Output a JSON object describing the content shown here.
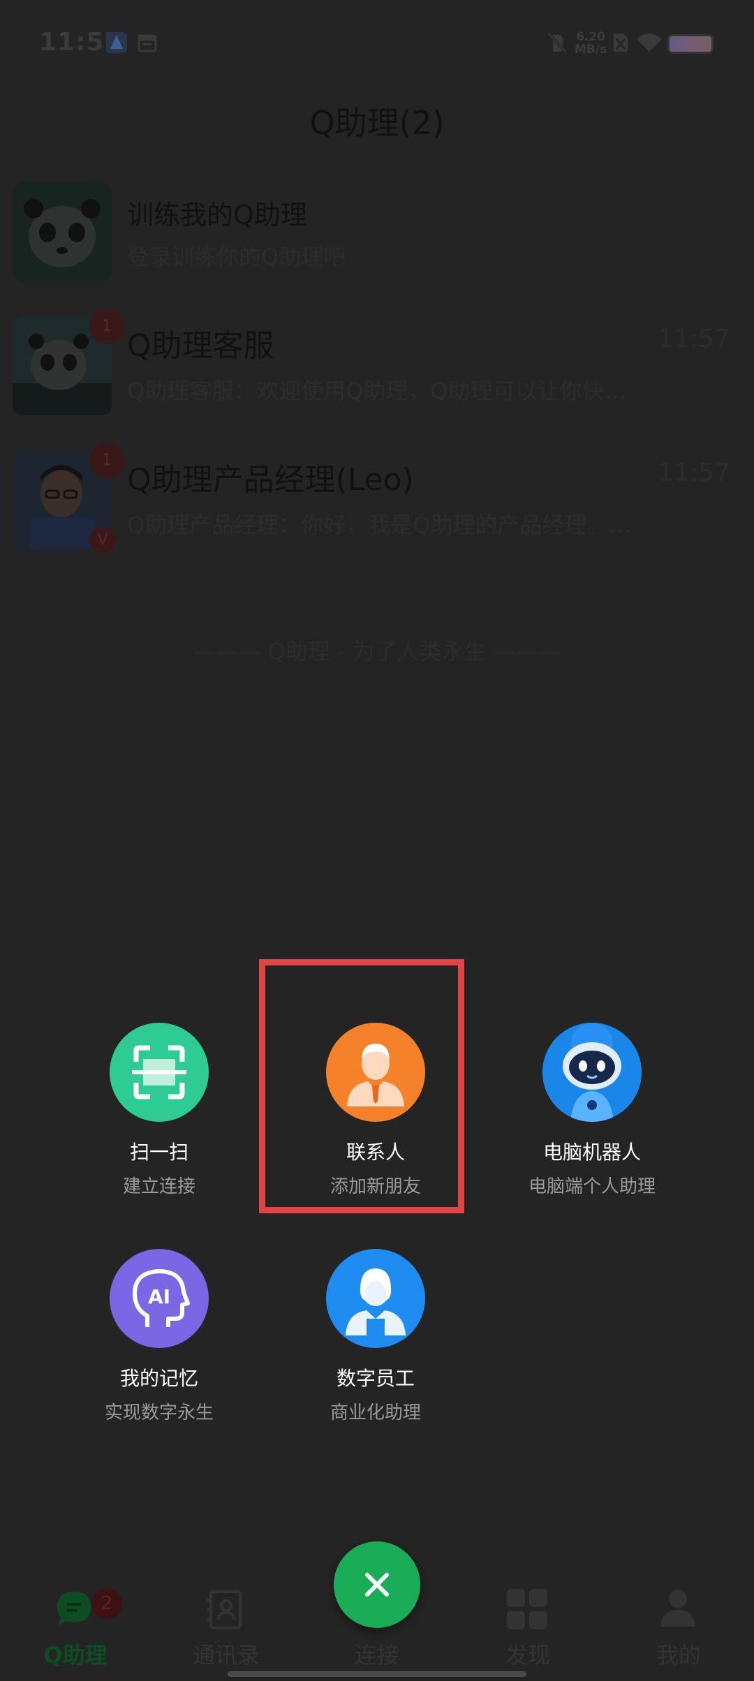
{
  "status_bar": {
    "time": "11:57",
    "net_speed_value": "6.20",
    "net_speed_unit": "MB/s",
    "icons": [
      "app-notification-icon",
      "calendar-icon",
      "mute-icon",
      "sim-icon",
      "wifi-icon",
      "battery-icon"
    ]
  },
  "header": {
    "title": "Q助理(2)"
  },
  "chats": [
    {
      "name": "训练我的Q助理",
      "preview": "登录训练你的Q助理吧",
      "time": "",
      "badge": ""
    },
    {
      "name": "Q助理客服",
      "preview": "Q助理客服：欢迎使用Q助理，Q助理可以让你快…",
      "time": "11:57",
      "badge": "1"
    },
    {
      "name": "Q助理产品经理(Leo)",
      "preview": "Q助理产品经理：你好，我是Q助理的产品经理。…",
      "time": "11:57",
      "badge": "1",
      "verified": "V"
    }
  ],
  "footer_slogan": "——— Q助理 - 为了人类永生 ———",
  "menu": [
    {
      "label": "扫一扫",
      "sub": "建立连接",
      "icon": "scan-icon",
      "color": "#2fcb94"
    },
    {
      "label": "联系人",
      "sub": "添加新朋友",
      "icon": "contact-person-icon",
      "color": "#f5822a"
    },
    {
      "label": "电脑机器人",
      "sub": "电脑端个人助理",
      "icon": "robot-icon",
      "color": "#1f7fe0"
    },
    {
      "label": "我的记忆",
      "sub": "实现数字永生",
      "icon": "ai-head-icon",
      "color": "#7b66e3"
    },
    {
      "label": "数字员工",
      "sub": "商业化助理",
      "icon": "employee-icon",
      "color": "#1f8cf2"
    }
  ],
  "bottom_nav": [
    {
      "label": "Q助理",
      "icon": "chat-bubble-icon",
      "badge": "2",
      "active": true
    },
    {
      "label": "通讯录",
      "icon": "contacts-book-icon"
    },
    {
      "label": "连接",
      "icon": "close-icon"
    },
    {
      "label": "发现",
      "icon": "grid-icon"
    },
    {
      "label": "我的",
      "icon": "person-icon"
    }
  ],
  "colors": {
    "background": "#242424",
    "fab": "#1aad57",
    "highlight": "#e04545",
    "active_tab": "#0e4d22"
  }
}
